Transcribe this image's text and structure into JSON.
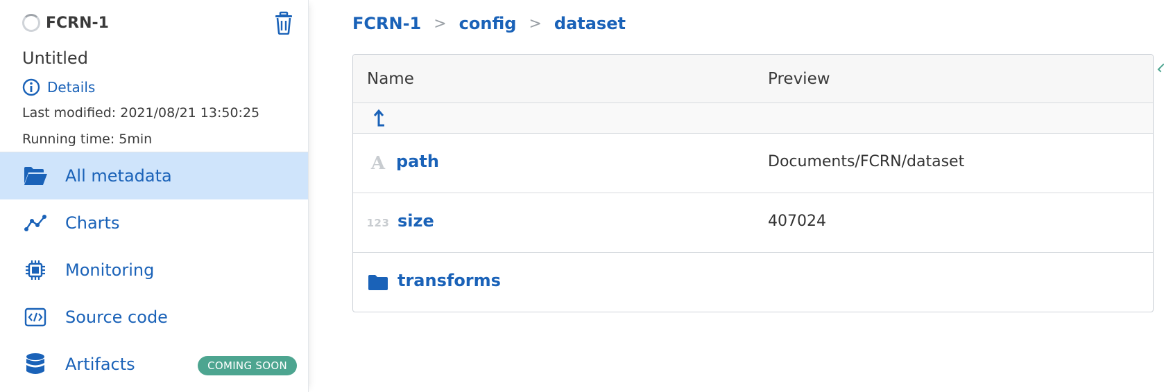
{
  "run": {
    "id": "FCRN-1",
    "name": "Untitled",
    "details_label": "Details",
    "last_modified": "Last modified: 2021/08/21 13:50:25",
    "running_time": "Running time: 5min"
  },
  "nav": {
    "items": [
      {
        "label": "All metadata",
        "icon": "folder-open-icon",
        "active": true
      },
      {
        "label": "Charts",
        "icon": "line-chart-icon",
        "active": false
      },
      {
        "label": "Monitoring",
        "icon": "cpu-chip-icon",
        "active": false
      },
      {
        "label": "Source code",
        "icon": "code-icon",
        "active": false
      },
      {
        "label": "Artifacts",
        "icon": "database-icon",
        "active": false,
        "badge": "COMING SOON"
      }
    ]
  },
  "breadcrumb": [
    "FCRN-1",
    "config",
    "dataset"
  ],
  "breadcrumb_separator": ">",
  "table": {
    "columns": {
      "name": "Name",
      "preview": "Preview"
    },
    "rows": [
      {
        "type_icon": "string-type-icon",
        "name": "path",
        "preview": "Documents/FCRN/dataset"
      },
      {
        "type_icon": "number-type-icon",
        "name": "size",
        "preview": "407024"
      },
      {
        "type_icon": "folder-icon",
        "name": "transforms",
        "preview": ""
      }
    ],
    "type_glyphs": {
      "string": "A",
      "number": "123"
    }
  },
  "colors": {
    "accent": "#1a62b8",
    "active_bg": "#cfe4fb",
    "badge_bg": "#4da590"
  }
}
